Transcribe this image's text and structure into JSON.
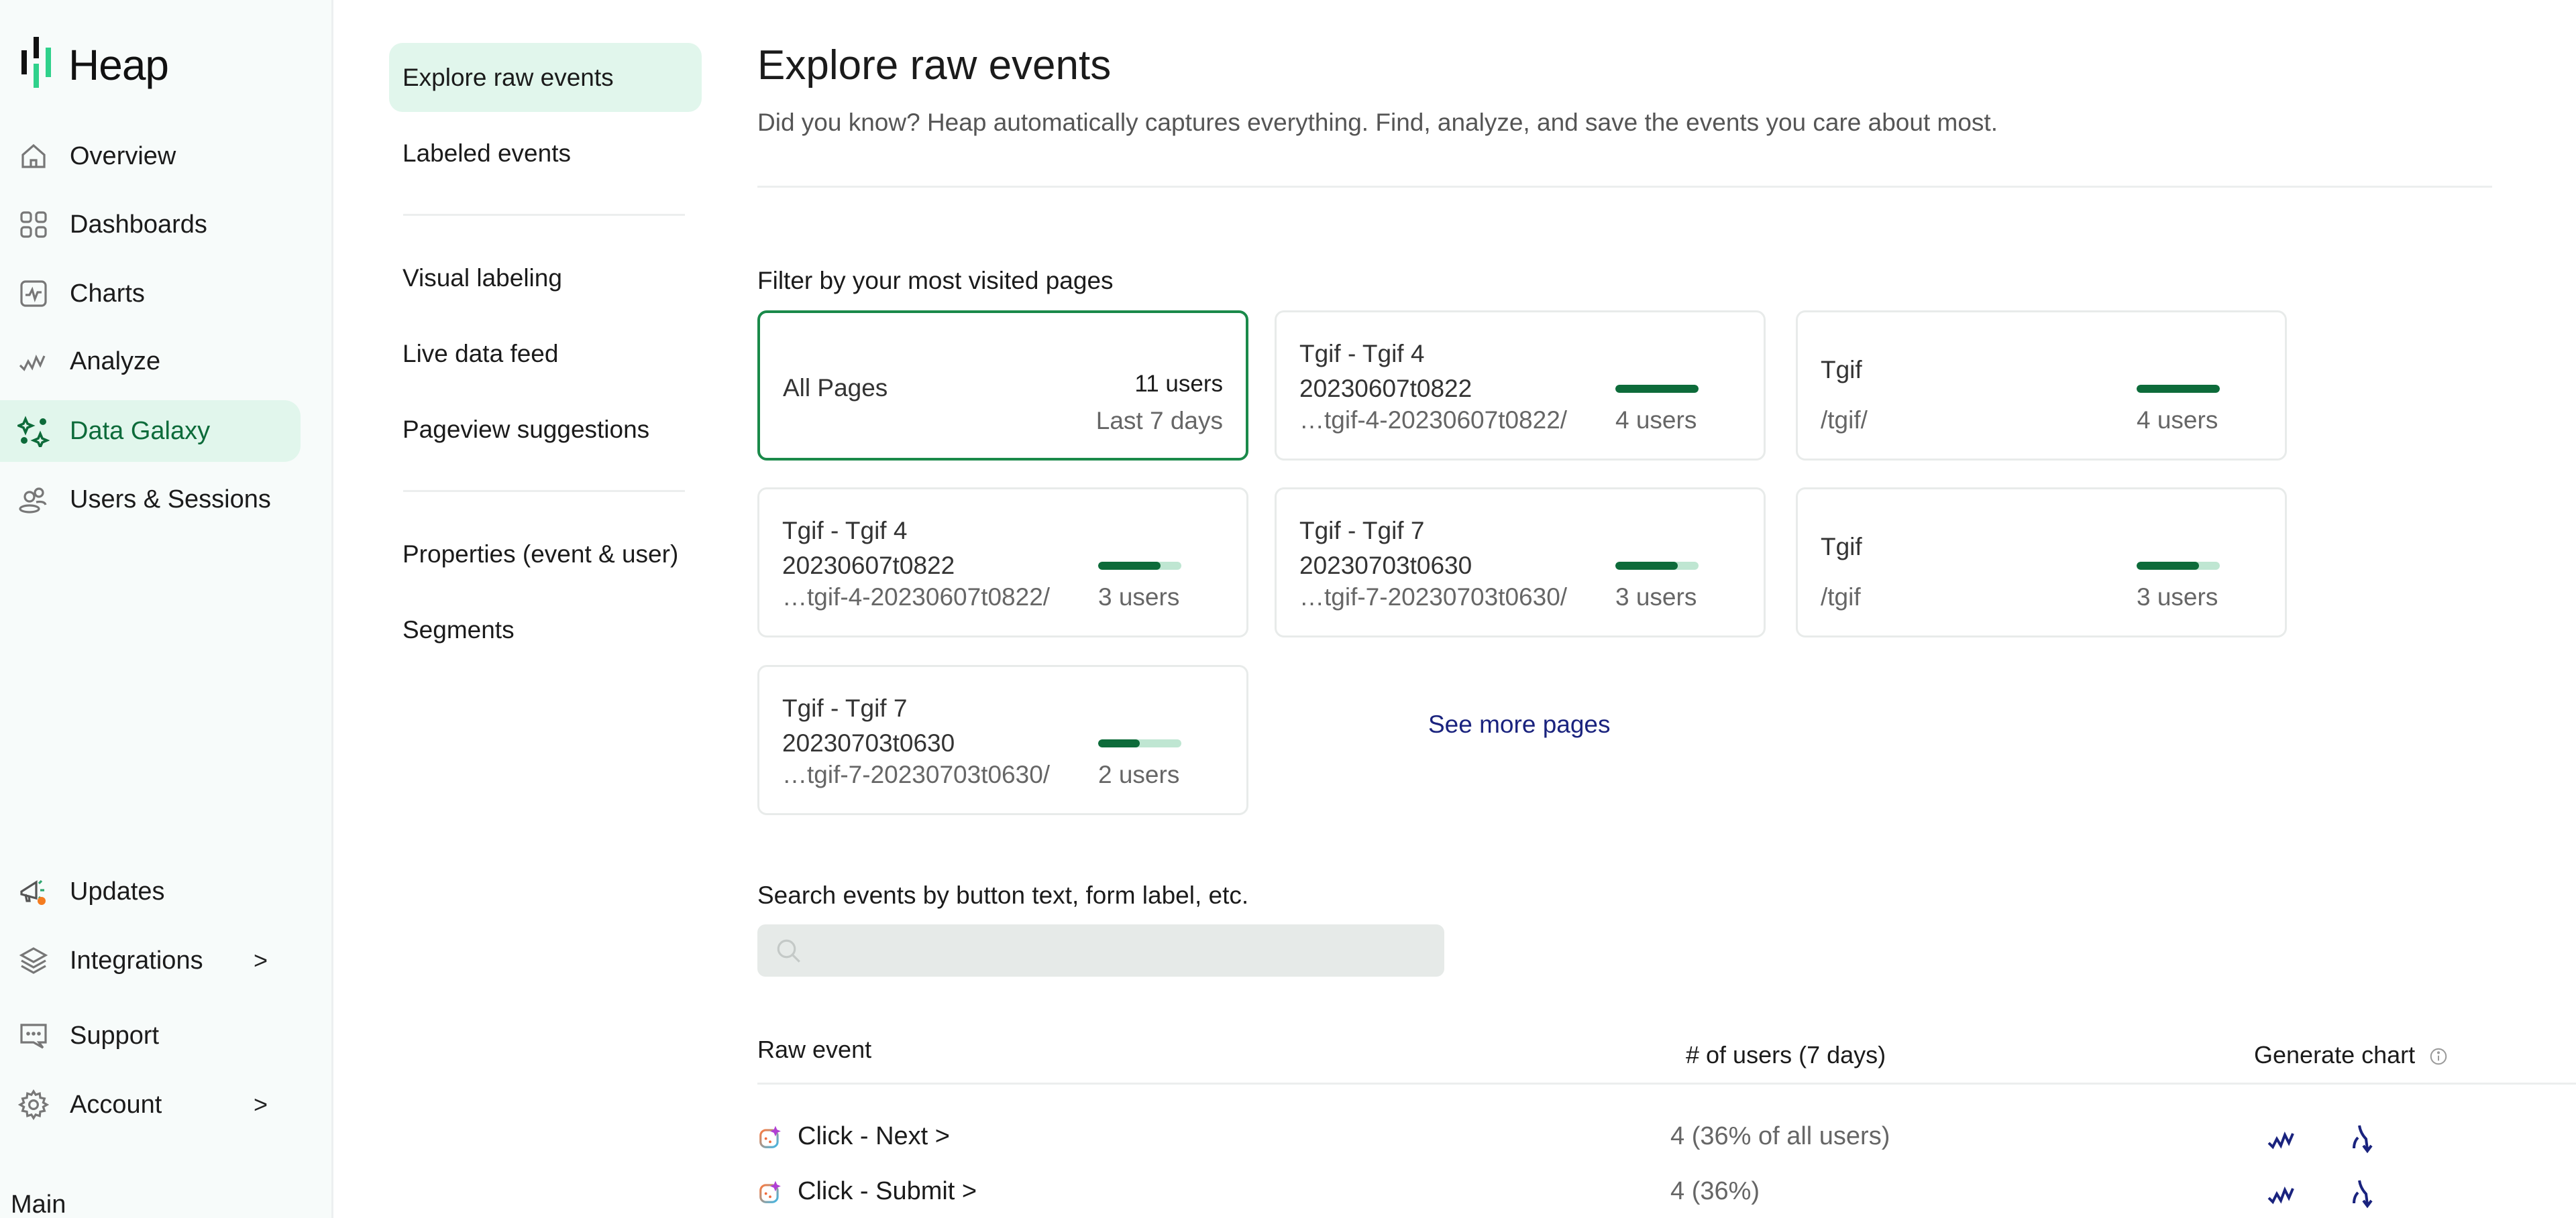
{
  "app": {
    "name": "Heap"
  },
  "colors": {
    "accent": "#0d6b3a",
    "accent_light": "#e1f6ec",
    "link": "#1a237e",
    "brand_green": "#2fd18b"
  },
  "sidebar": {
    "items": [
      {
        "label": "Overview",
        "icon": "home-icon"
      },
      {
        "label": "Dashboards",
        "icon": "dashboards-grid-icon"
      },
      {
        "label": "Charts",
        "icon": "charts-icon"
      },
      {
        "label": "Analyze",
        "icon": "analyze-wave-icon"
      },
      {
        "label": "Data Galaxy",
        "icon": "sparkles-icon",
        "active": true
      },
      {
        "label": "Users & Sessions",
        "icon": "users-icon"
      }
    ],
    "bottom_items": [
      {
        "label": "Updates",
        "icon": "megaphone-icon",
        "badge": "notification-dot"
      },
      {
        "label": "Integrations",
        "icon": "layers-icon",
        "chevron": ">"
      },
      {
        "label": "Support",
        "icon": "chat-bubble-icon"
      },
      {
        "label": "Account",
        "icon": "gear-icon",
        "chevron": ">"
      }
    ],
    "environment": "Main"
  },
  "subnav": {
    "items": [
      {
        "label": "Explore raw events",
        "active": true
      },
      {
        "label": "Labeled events"
      },
      {
        "label": "Visual labeling"
      },
      {
        "label": "Live data feed"
      },
      {
        "label": "Pageview suggestions"
      },
      {
        "label": "Properties (event & user)"
      },
      {
        "label": "Segments"
      }
    ]
  },
  "main": {
    "title": "Explore raw events",
    "subtitle": "Did you know? Heap automatically captures everything. Find, analyze, and save the events you care about most.",
    "filter_label": "Filter by your most visited pages",
    "all_pages": {
      "name": "All Pages",
      "users": "11 users",
      "period": "Last 7 days"
    },
    "pages": [
      {
        "name": "Tgif - Tgif 4 20230607t0822",
        "path": "…tgif-4-20230607t0822/",
        "users": "4 users",
        "share": 1.0
      },
      {
        "name": "Tgif",
        "path": "/tgif/",
        "users": "4 users",
        "share": 1.0
      },
      {
        "name": "Tgif - Tgif 4 20230607t0822",
        "path": "…tgif-4-20230607t0822/",
        "users": "3 users",
        "share": 0.75
      },
      {
        "name": "Tgif - Tgif 7 20230703t0630",
        "path": "…tgif-7-20230703t0630/",
        "users": "3 users",
        "share": 0.75
      },
      {
        "name": "Tgif",
        "path": "/tgif",
        "users": "3 users",
        "share": 0.75
      },
      {
        "name": "Tgif - Tgif 7 20230703t0630",
        "path": "…tgif-7-20230703t0630/",
        "users": "2 users",
        "share": 0.5
      }
    ],
    "see_more": "See more pages",
    "search_label": "Search events by button text, form label, etc.",
    "search_value": "",
    "search_placeholder": "",
    "table": {
      "headers": {
        "event": "Raw event",
        "users": "# of users (7 days)",
        "chart": "Generate chart"
      },
      "rows": [
        {
          "event": "Click - Next >",
          "users": "4 (36% of all users)"
        },
        {
          "event": "Click - Submit >",
          "users": "4 (36%)"
        }
      ],
      "chart_actions": [
        "graph-chart-icon",
        "funnel-chart-icon"
      ]
    }
  }
}
